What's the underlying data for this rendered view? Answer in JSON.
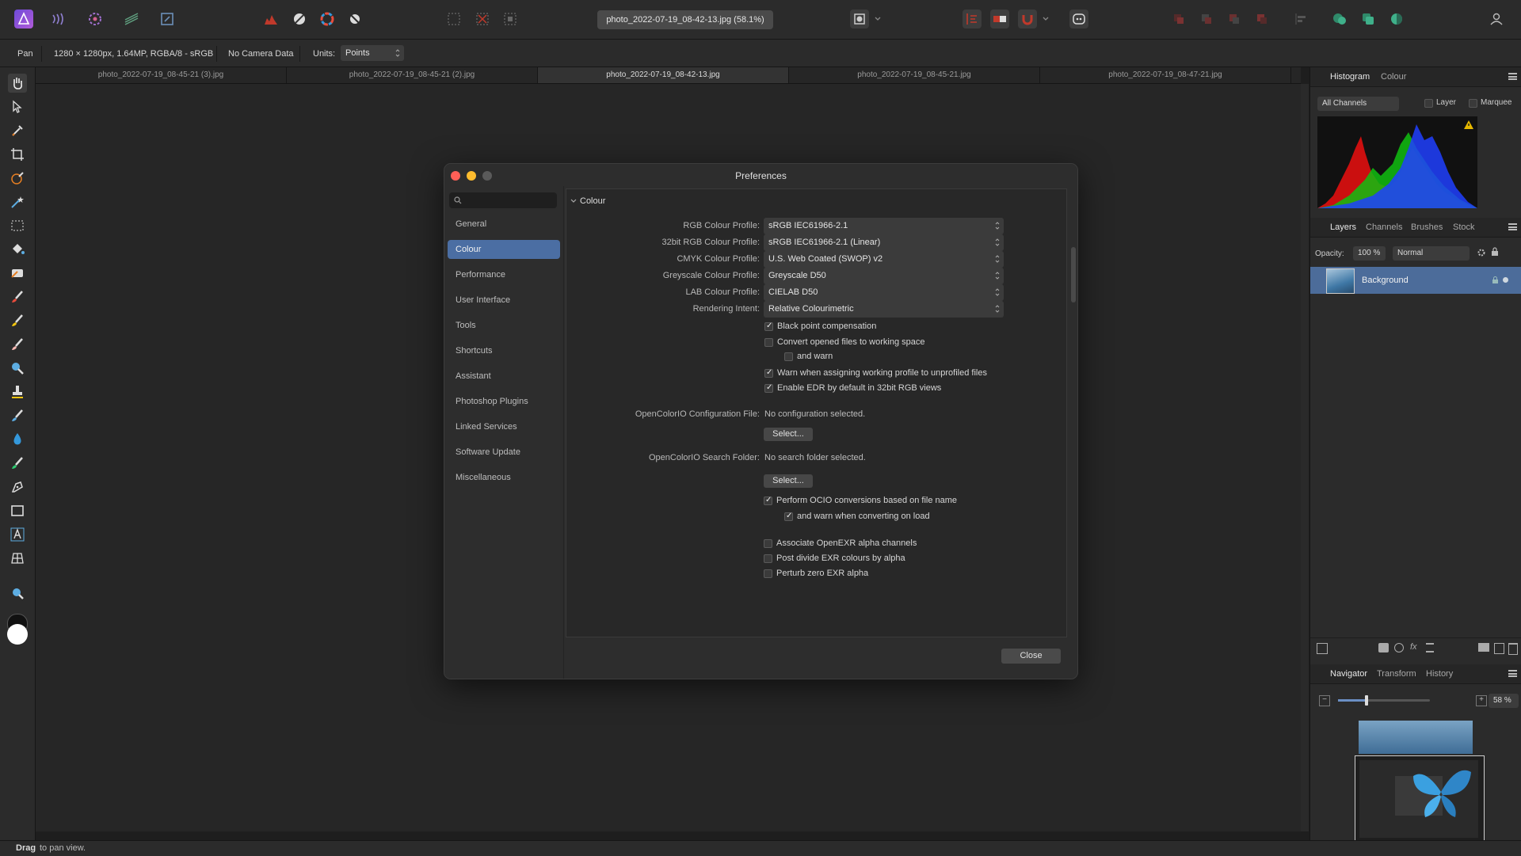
{
  "app": {
    "document_title": "photo_2022-07-19_08-42-13.jpg (58.1%)"
  },
  "context_bar": {
    "tool": "Pan",
    "doc_info": "1280 × 1280px, 1.64MP, RGBA/8 - sRGB",
    "camera": "No Camera Data",
    "units_label": "Units:",
    "units_value": "Points"
  },
  "tabs": [
    "photo_2022-07-19_08-45-21 (3).jpg",
    "photo_2022-07-19_08-45-21 (2).jpg",
    "photo_2022-07-19_08-42-13.jpg",
    "photo_2022-07-19_08-45-21.jpg",
    "photo_2022-07-19_08-47-21.jpg"
  ],
  "right_panel": {
    "histogram_tabs": [
      "Histogram",
      "Colour"
    ],
    "channels": "All Channels",
    "layer_label": "Layer",
    "marquee_label": "Marquee",
    "layers_tabs": [
      "Layers",
      "Channels",
      "Brushes",
      "Stock"
    ],
    "opacity_label": "Opacity:",
    "opacity_value": "100 %",
    "blend_mode": "Normal",
    "layer_name": "Background",
    "nav_tabs": [
      "Navigator",
      "Transform",
      "History"
    ],
    "zoom_value": "58 %"
  },
  "status": {
    "bold": "Drag",
    "text": " to pan view."
  },
  "dialog": {
    "title": "Preferences",
    "sidebar": [
      "General",
      "Colour",
      "Performance",
      "User Interface",
      "Tools",
      "Shortcuts",
      "Assistant",
      "Photoshop Plugins",
      "Linked Services",
      "Software Update",
      "Miscellaneous"
    ],
    "section": "Colour",
    "rgb_label": "RGB Colour Profile:",
    "rgb_value": "sRGB IEC61966-2.1",
    "rgb32_label": "32bit RGB Colour Profile:",
    "rgb32_value": "sRGB IEC61966-2.1 (Linear)",
    "cmyk_label": "CMYK Colour Profile:",
    "cmyk_value": "U.S. Web Coated (SWOP) v2",
    "grey_label": "Greyscale Colour Profile:",
    "grey_value": "Greyscale D50",
    "lab_label": "LAB Colour Profile:",
    "lab_value": "CIELAB D50",
    "intent_label": "Rendering Intent:",
    "intent_value": "Relative Colourimetric",
    "cb_black_point": "Black point compensation",
    "cb_convert": "Convert opened files to working space",
    "cb_and_warn": "and warn",
    "cb_warn_assign": "Warn when assigning working profile to unprofiled files",
    "cb_edr": "Enable EDR by default in 32bit RGB views",
    "ocio_config_label": "OpenColorIO Configuration File:",
    "ocio_config_value": "No configuration selected.",
    "ocio_folder_label": "OpenColorIO Search Folder:",
    "ocio_folder_value": "No search folder selected.",
    "select_label": "Select...",
    "cb_ocio_filename": "Perform OCIO conversions based on file name",
    "cb_ocio_warn": "and warn when converting on load",
    "cb_exr_assoc": "Associate OpenEXR alpha channels",
    "cb_exr_divide": "Post divide EXR colours by alpha",
    "cb_exr_perturb": "Perturb zero EXR alpha",
    "close_label": "Close"
  },
  "colors": {
    "accent": "#4b6ea3",
    "brand": "#6e4bd8"
  }
}
